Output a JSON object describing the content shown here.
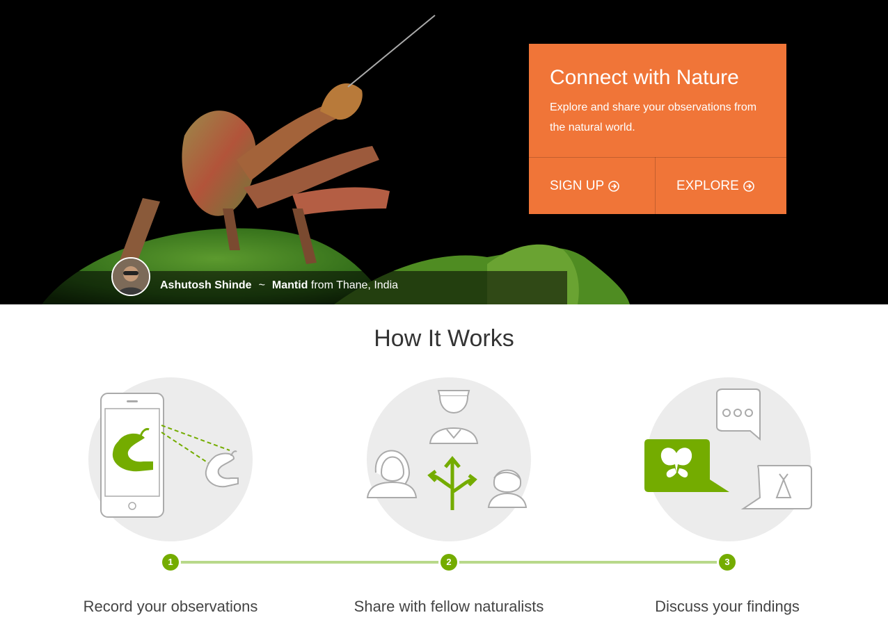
{
  "hero": {
    "cta_title": "Connect with Nature",
    "cta_text": "Explore and share your observations from the natural world.",
    "signup_label": "SIGN UP",
    "explore_label": "EXPLORE",
    "accent_color": "#f07538",
    "photo_credit": {
      "observer": "Ashutosh Shinde",
      "separator": "~",
      "species": "Mantid",
      "location": "from Thane, India"
    }
  },
  "how_it_works": {
    "title": "How It Works",
    "steps": [
      {
        "number": "1",
        "label": "Record your observations",
        "icon": "phone-caterpillar-icon"
      },
      {
        "number": "2",
        "label": "Share with fellow naturalists",
        "icon": "naturalists-share-icon"
      },
      {
        "number": "3",
        "label": "Discuss your findings",
        "icon": "discussion-bubbles-icon"
      }
    ],
    "step_color": "#74ac00"
  }
}
